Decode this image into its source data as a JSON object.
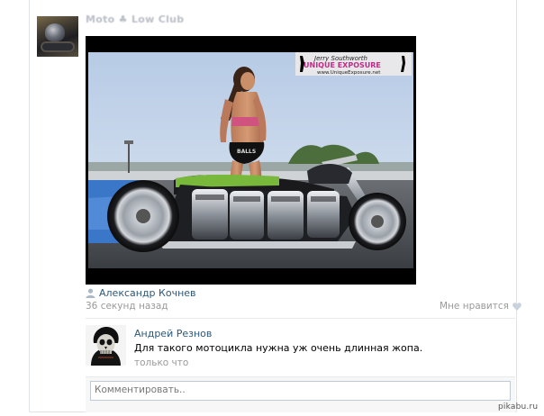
{
  "post": {
    "group_name": "Moto ♣ Low Club",
    "author": "Александр Кочнев",
    "time": "36 секунд назад",
    "like_label": "Мне нравится"
  },
  "photo": {
    "brand_line1": "Jerry Southworth",
    "brand_line2": "UNIQUE EXPOSURE",
    "brand_url": "www.UniqueExposure.net",
    "shorts_text": "BALLS"
  },
  "comment": {
    "author": "Андрей Резнов",
    "text": "Для такого мотоцикла нужна уж очень длинная жопа.",
    "time": "только что"
  },
  "comment_box": {
    "placeholder": "Комментировать.."
  },
  "watermark": "pikabu.ru",
  "colors": {
    "link": "#2b587a",
    "muted": "#999999",
    "border": "#c0cad5"
  }
}
